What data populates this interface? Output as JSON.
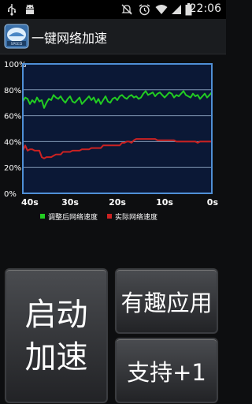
{
  "status_bar": {
    "time": "22:06",
    "left_icons": [
      "usb-icon",
      "android-icon"
    ],
    "right_icons": [
      "mute-icon",
      "alarm-icon",
      "wifi-icon",
      "signal-icon",
      "battery-icon"
    ]
  },
  "app": {
    "title": "一键网络加速",
    "logo_icon": "speed-booster-logo-icon"
  },
  "chart_data": {
    "type": "line",
    "y_tick_labels": [
      "100%",
      "80%",
      "60%",
      "40%",
      "20%",
      "0%"
    ],
    "x_tick_labels": [
      "40s",
      "30s",
      "20s",
      "10s",
      "0s"
    ],
    "ylim": [
      0,
      100
    ],
    "xlim": [
      40,
      0
    ],
    "x_unit": "s",
    "grid": true,
    "legend_position": "bottom",
    "x": [
      40,
      39.5,
      39,
      38.5,
      38,
      37.5,
      37,
      36.5,
      36,
      35.5,
      35,
      34.5,
      34,
      33.5,
      33,
      32.5,
      32,
      31.5,
      31,
      30.5,
      30,
      29.5,
      29,
      28.5,
      28,
      27.5,
      27,
      26.5,
      26,
      25.5,
      25,
      24.5,
      24,
      23.5,
      23,
      22.5,
      22,
      21.5,
      21,
      20.5,
      20,
      19.5,
      19,
      18.5,
      18,
      17.5,
      17,
      16.5,
      16,
      15.5,
      15,
      14.5,
      14,
      13.5,
      13,
      12.5,
      12,
      11.5,
      11,
      10.5,
      10,
      9.5,
      9,
      8.5,
      8,
      7.5,
      7,
      6.5,
      6,
      5.5,
      5,
      4.5,
      4,
      3.5,
      3,
      2.5,
      2,
      1.5,
      1,
      0.5,
      0
    ],
    "series": [
      {
        "name": "调整后网络速度",
        "color": "#22cc22",
        "values": [
          71,
          74,
          73,
          69,
          72,
          70,
          74,
          71,
          72,
          66,
          70,
          73,
          72,
          76,
          74,
          73,
          75,
          72,
          70,
          73,
          75,
          71,
          70,
          72,
          74,
          69,
          71,
          73,
          75,
          72,
          74,
          70,
          73,
          69,
          72,
          75,
          71,
          70,
          73,
          74,
          72,
          75,
          76,
          74,
          73,
          75,
          76,
          74,
          75,
          73,
          74,
          77,
          79,
          76,
          77,
          78,
          75,
          77,
          78,
          76,
          74,
          76,
          78,
          77,
          74,
          76,
          75,
          77,
          79,
          76,
          75,
          74,
          77,
          75,
          76,
          73,
          75,
          77,
          74,
          76,
          78
        ]
      },
      {
        "name": "实际网络速度",
        "color": "#cc2222",
        "values": [
          33,
          37,
          33,
          34,
          34,
          33,
          33,
          33,
          28,
          27,
          28,
          28,
          28,
          29,
          30,
          30,
          30,
          32,
          32,
          32,
          32,
          33,
          33,
          33,
          33,
          34,
          34,
          34,
          34,
          35,
          35,
          35,
          35,
          35,
          37,
          37,
          37,
          37,
          37,
          37,
          37,
          37,
          39,
          39,
          40,
          40,
          39,
          41,
          42,
          42,
          42,
          42,
          42,
          42,
          42,
          42,
          42,
          41,
          41,
          41,
          41,
          41,
          41,
          41,
          41,
          40,
          40,
          40,
          40,
          40,
          40,
          40,
          40,
          40,
          39,
          40,
          40,
          40,
          40,
          40,
          40
        ]
      }
    ]
  },
  "buttons": {
    "start_line1": "启动",
    "start_line2": "加速",
    "fun_apps": "有趣应用",
    "support": "支持+1"
  },
  "colors": {
    "chart_bg": "#0b1836",
    "grid_line": "#7f95b2",
    "frame": "#4f8fd6"
  }
}
